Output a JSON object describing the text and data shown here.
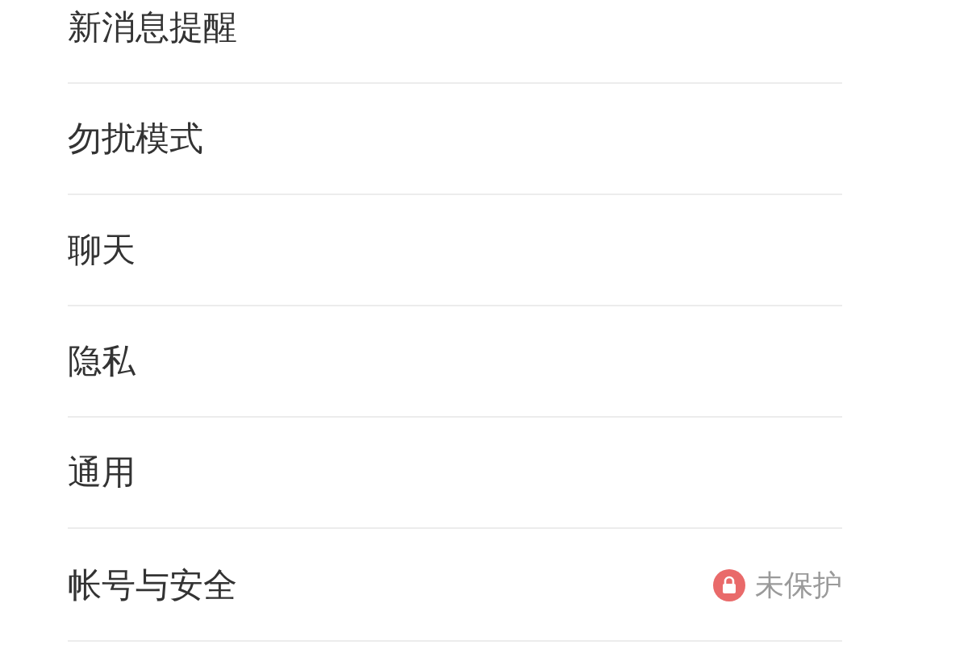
{
  "settings": [
    {
      "label": "新消息提醒"
    },
    {
      "label": "勿扰模式"
    },
    {
      "label": "聊天"
    },
    {
      "label": "隐私"
    },
    {
      "label": "通用"
    },
    {
      "label": "帐号与安全",
      "status": "未保护"
    }
  ]
}
